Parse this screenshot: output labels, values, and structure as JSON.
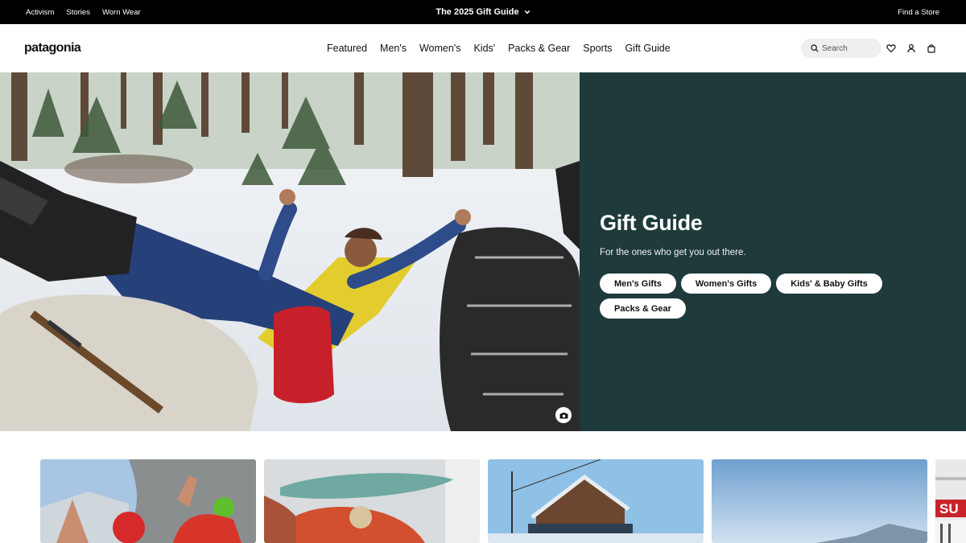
{
  "utility": {
    "links": [
      "Activism",
      "Stories",
      "Worn Wear"
    ],
    "promo": "The 2025 Gift Guide",
    "store_link": "Find a Store"
  },
  "header": {
    "logo": "patagonia",
    "nav": [
      "Featured",
      "Men's",
      "Women's",
      "Kids'",
      "Packs & Gear",
      "Sports",
      "Gift Guide"
    ],
    "search_placeholder": "Search",
    "icons": [
      "heart-icon",
      "account-icon",
      "bag-icon"
    ]
  },
  "hero": {
    "title": "Gift Guide",
    "subtitle": "For the ones who get you out there.",
    "buttons": [
      "Men's Gifts",
      "Women's Gifts",
      "Kids' & Baby Gifts",
      "Packs & Gear"
    ],
    "panel_color": "#1f3a3a",
    "photo_credit_icon": "camera-icon"
  },
  "cards": [
    {
      "name": "climbers-card"
    },
    {
      "name": "surfboard-card"
    },
    {
      "name": "mountain-house-card"
    },
    {
      "name": "sky-landscape-card"
    },
    {
      "name": "storefront-card",
      "sign_text": "SU"
    }
  ]
}
